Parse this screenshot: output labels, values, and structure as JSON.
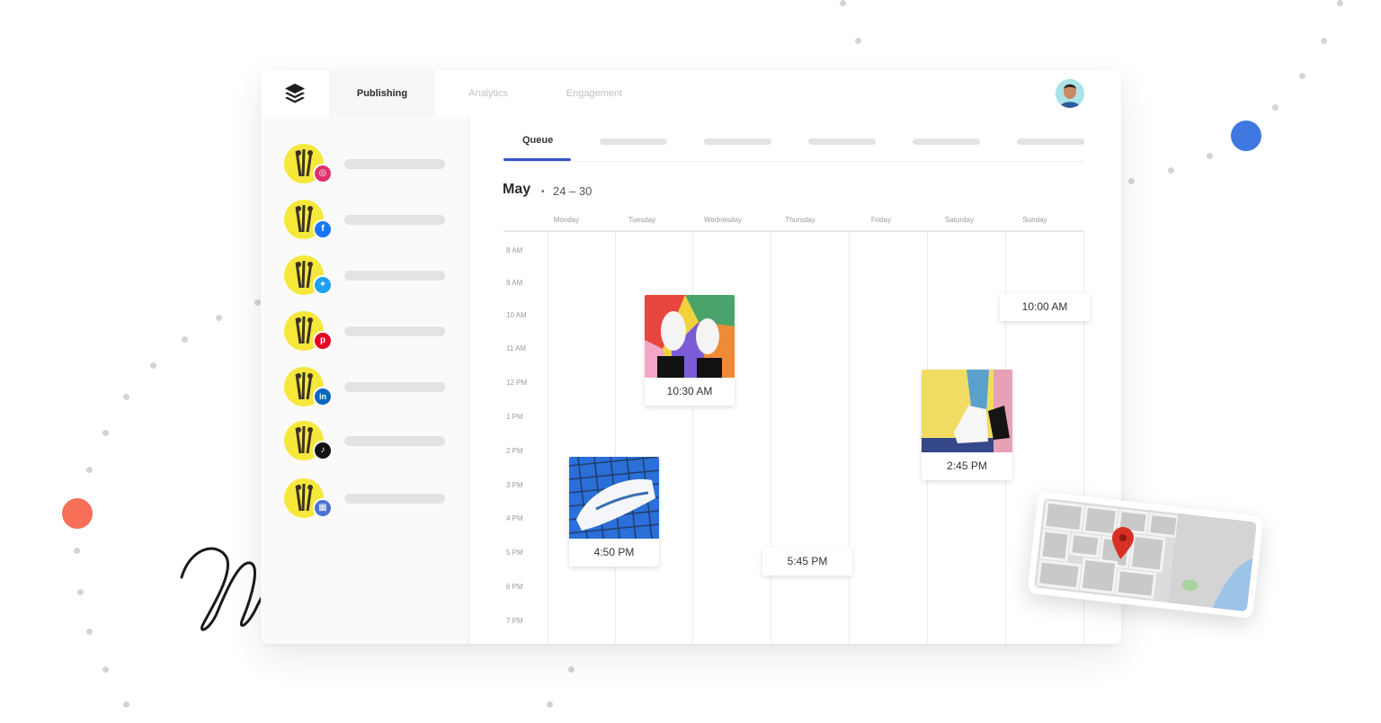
{
  "colors": {
    "accent_blue": "#3552cc",
    "decor_blue": "#3f78e0",
    "decor_coral": "#f76f57",
    "instagram": "#e1306c",
    "facebook": "#1877f2",
    "twitter": "#1da1f2",
    "pinterest": "#e60023",
    "linkedin": "#0a66c2",
    "tiktok": "#111111",
    "buffer_page": "#4a73d1",
    "map_pin": "#d93025"
  },
  "nav": {
    "logo_icon": "buffer-stack-icon",
    "tabs": [
      {
        "label": "Publishing",
        "active": true
      },
      {
        "label": "Analytics",
        "active": false
      },
      {
        "label": "Engagement",
        "active": false
      }
    ]
  },
  "sidebar": {
    "accounts": [
      {
        "network": "instagram",
        "badge_icon": "instagram-icon",
        "glyph": "◎"
      },
      {
        "network": "facebook",
        "badge_icon": "facebook-icon",
        "glyph": "f"
      },
      {
        "network": "twitter",
        "badge_icon": "twitter-icon",
        "glyph": "✦"
      },
      {
        "network": "pinterest",
        "badge_icon": "pinterest-icon",
        "glyph": "p"
      },
      {
        "network": "linkedin",
        "badge_icon": "linkedin-icon",
        "glyph": "in"
      },
      {
        "network": "tiktok",
        "badge_icon": "tiktok-icon",
        "glyph": "♪"
      },
      {
        "network": "shop",
        "badge_icon": "storefront-icon",
        "glyph": "▦"
      }
    ]
  },
  "main": {
    "tabs": {
      "queue": "Queue"
    },
    "calendar": {
      "month": "May",
      "separator": "•",
      "range": "24 – 30",
      "days": [
        "Monday",
        "Tuesday",
        "Wednesday",
        "Thursday",
        "Friday",
        "Saturday",
        "Sunday"
      ],
      "hours": [
        "8 AM",
        "9 AM",
        "10 AM",
        "11 AM",
        "12 PM",
        "1 PM",
        "2 PM",
        "3 PM",
        "4 PM",
        "5 PM",
        "6 PM",
        "7 PM"
      ],
      "posts": [
        {
          "day": "Tuesday",
          "time": "10:30 AM",
          "image": "sneakers-on-colorful-floor"
        },
        {
          "day": "Sunday",
          "time": "10:00 AM",
          "image": null
        },
        {
          "day": "Saturday",
          "time": "2:45 PM",
          "image": "sneaker-on-yellow-wall"
        },
        {
          "day": "Monday",
          "time": "4:50 PM",
          "image": "sneaker-on-blue-grid"
        },
        {
          "day": "Thursday",
          "time": "5:45 PM",
          "image": null
        }
      ]
    }
  }
}
